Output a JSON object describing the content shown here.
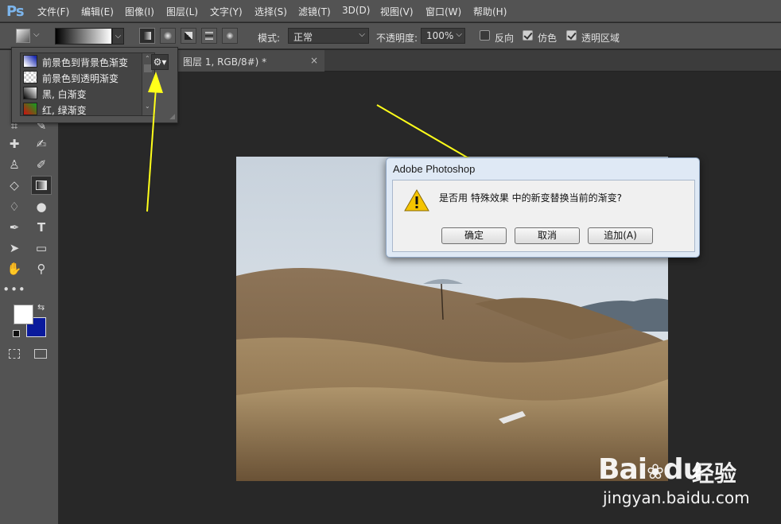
{
  "app": {
    "logo": "Ps"
  },
  "menu": [
    "文件(F)",
    "编辑(E)",
    "图像(I)",
    "图层(L)",
    "文字(Y)",
    "选择(S)",
    "滤镜(T)",
    "3D(D)",
    "视图(V)",
    "窗口(W)",
    "帮助(H)"
  ],
  "options": {
    "mode_label": "模式:",
    "mode_value": "正常",
    "opacity_label": "不透明度:",
    "opacity_value": "100%",
    "reverse_label": "反向",
    "reverse_checked": false,
    "dither_label": "仿色",
    "dither_checked": true,
    "transparency_label": "透明区域",
    "transparency_checked": true
  },
  "document_tab": {
    "label": "图层 1, RGB/8#) *"
  },
  "gradient_picker": {
    "items": [
      {
        "label": "前景色到背景色渐变",
        "swatch": "fg-bg"
      },
      {
        "label": "前景色到透明渐变",
        "swatch": "fg-transparent"
      },
      {
        "label": "黑, 白渐变",
        "swatch": "black-white"
      },
      {
        "label": "红, 绿渐变",
        "swatch": "red-green"
      }
    ],
    "gear_icon": "gear-icon"
  },
  "colors": {
    "foreground": "#ffffff",
    "background": "#0a1a9c",
    "arrow": "#ffff1a",
    "ui_dark": "#535353",
    "workspace": "#282828"
  },
  "dialog": {
    "title": "Adobe Photoshop",
    "message": "是否用 特殊效果 中的新变替换当前的渐变?",
    "buttons": {
      "ok": "确定",
      "cancel": "取消",
      "append": "追加(A)"
    },
    "icon": "warning-icon"
  },
  "watermark": {
    "brand": "Bai",
    "brand_paw": "du",
    "chinese": "经验",
    "url": "jingyan.baidu.com"
  }
}
